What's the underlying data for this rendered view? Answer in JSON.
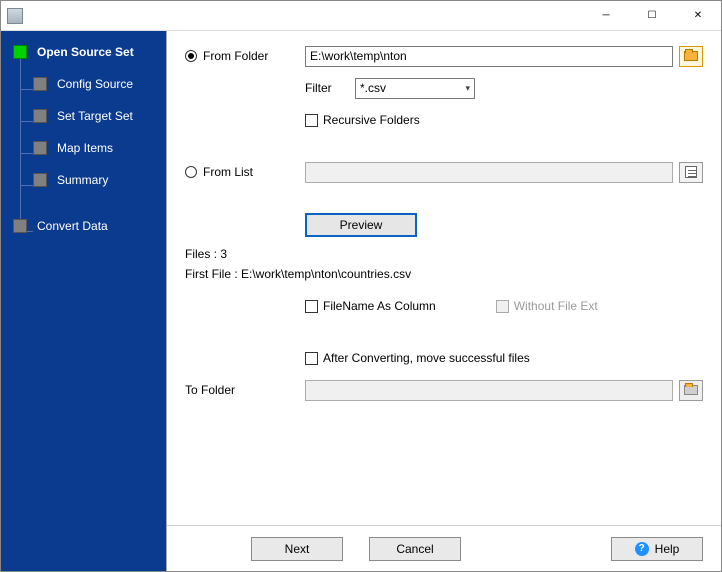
{
  "sidebar": {
    "items": [
      {
        "label": "Open Source Set",
        "active": true
      },
      {
        "label": "Config Source"
      },
      {
        "label": "Set Target Set"
      },
      {
        "label": "Map Items"
      },
      {
        "label": "Summary"
      },
      {
        "label": "Convert Data"
      }
    ]
  },
  "form": {
    "from_folder_label": "From Folder",
    "from_folder_value": "E:\\work\\temp\\nton",
    "filter_label": "Filter",
    "filter_value": "*.csv",
    "recursive_label": "Recursive Folders",
    "from_list_label": "From List",
    "from_list_value": "",
    "preview_label": "Preview",
    "files_count_label": "Files : 3",
    "first_file_label": "First File : E:\\work\\temp\\nton\\countries.csv",
    "filename_col_label": "FileName As Column",
    "without_ext_label": "Without File Ext",
    "after_convert_label": "After Converting, move successful files",
    "to_folder_label": "To Folder",
    "to_folder_value": ""
  },
  "footer": {
    "next": "Next",
    "cancel": "Cancel",
    "help": "Help"
  }
}
